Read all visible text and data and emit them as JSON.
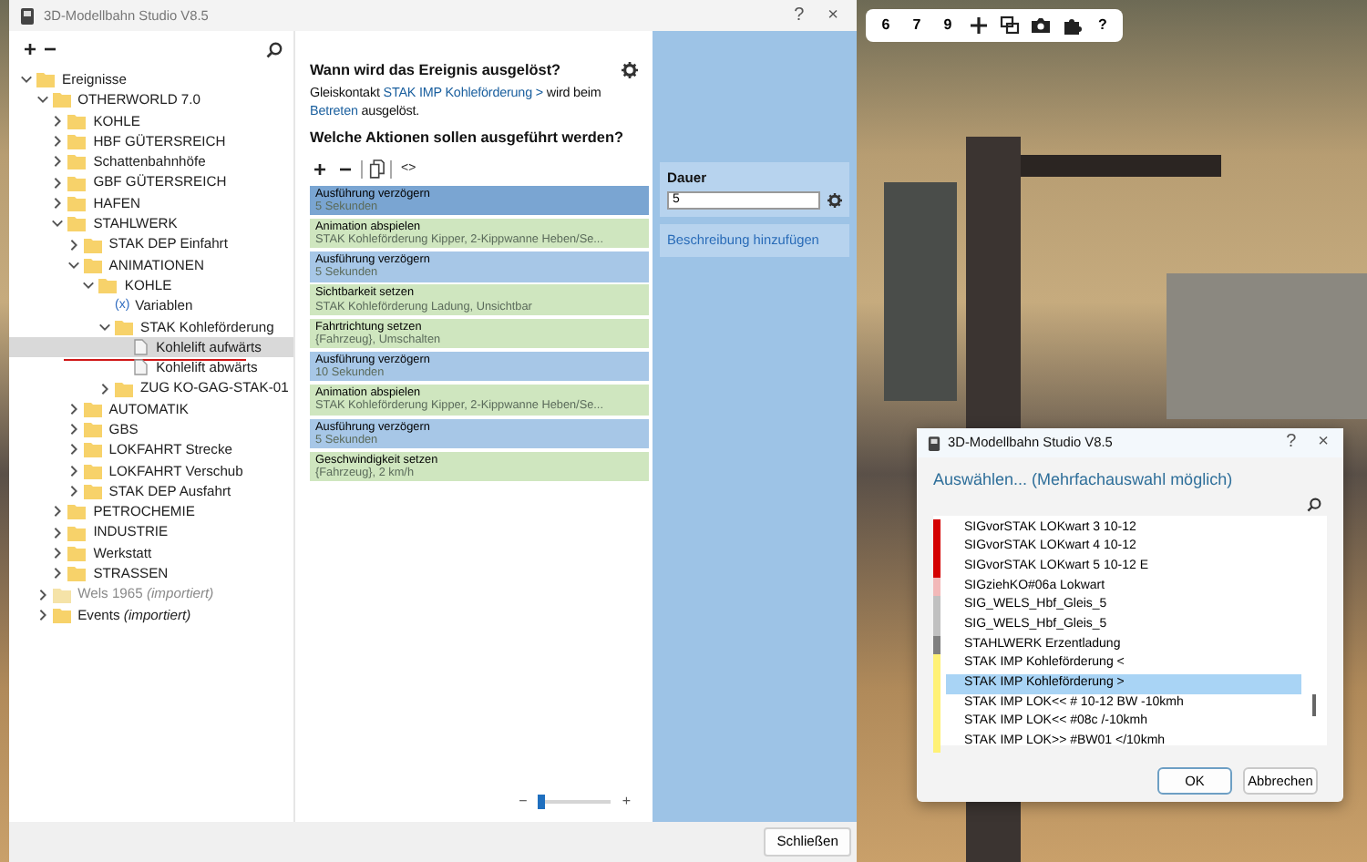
{
  "main_window": {
    "title": "3D-Modellbahn Studio V8.5",
    "help_button": "?",
    "close_button": "×"
  },
  "tree_toolbar": {
    "add_button": "+",
    "remove_button": "−"
  },
  "tree": [
    {
      "label": "Ereignisse",
      "kind": "folder",
      "expanded": true,
      "children": [
        {
          "label": "OTHERWORLD  7.0",
          "kind": "folder",
          "expanded": true,
          "children": [
            {
              "label": "KOHLE",
              "kind": "folder",
              "expanded": false
            },
            {
              "label": "HBF  GÜTERSREICH",
              "kind": "folder",
              "expanded": false
            },
            {
              "label": "Schattenbahnhöfe",
              "kind": "folder",
              "expanded": false
            },
            {
              "label": "GBF  GÜTERSREICH",
              "kind": "folder",
              "expanded": false
            },
            {
              "label": "HAFEN",
              "kind": "folder",
              "expanded": false
            },
            {
              "label": "STAHLWERK",
              "kind": "folder",
              "expanded": true,
              "children": [
                {
                  "label": "STAK  DEP  Einfahrt",
                  "kind": "folder",
                  "expanded": false
                },
                {
                  "label": "ANIMATIONEN",
                  "kind": "folder",
                  "expanded": true,
                  "children": [
                    {
                      "label": "KOHLE",
                      "kind": "folder",
                      "expanded": true,
                      "children": [
                        {
                          "label": "Variablen",
                          "kind": "variable",
                          "glyph": "(x)"
                        },
                        {
                          "label": "STAK  Kohleförderung",
                          "kind": "folder",
                          "expanded": true,
                          "children": [
                            {
                              "label": "Kohlelift aufwärts",
                              "kind": "document",
                              "selected": true,
                              "marked": true
                            },
                            {
                              "label": "Kohlelift abwärts",
                              "kind": "document",
                              "selected": false,
                              "marked": false
                            }
                          ]
                        },
                        {
                          "label": "ZUG  KO-GAG-STAK-01",
                          "kind": "folder",
                          "expanded": false
                        }
                      ]
                    }
                  ]
                },
                {
                  "label": "AUTOMATIK",
                  "kind": "folder",
                  "expanded": false
                },
                {
                  "label": "GBS",
                  "kind": "folder",
                  "expanded": false
                },
                {
                  "label": "LOKFAHRT  Strecke",
                  "kind": "folder",
                  "expanded": false
                },
                {
                  "label": "LOKFAHRT  Verschub",
                  "kind": "folder",
                  "expanded": false
                },
                {
                  "label": "STAK  DEP  Ausfahrt",
                  "kind": "folder",
                  "expanded": false
                }
              ]
            },
            {
              "label": "PETROCHEMIE",
              "kind": "folder",
              "expanded": false
            },
            {
              "label": "INDUSTRIE",
              "kind": "folder",
              "expanded": false
            },
            {
              "label": "Werkstatt",
              "kind": "folder",
              "expanded": false
            },
            {
              "label": "STRASSEN",
              "kind": "folder",
              "expanded": false
            }
          ]
        },
        {
          "label": "Wels 1965 *(importiert)*",
          "kind": "folder",
          "expanded": false,
          "disabled": true
        },
        {
          "label": "Events *(importiert)*",
          "kind": "folder",
          "expanded": false,
          "disabled": false
        }
      ]
    }
  ],
  "trigger": {
    "heading": "Wann wird das Ereignis ausgelöst?",
    "prefix": "Gleiskontakt",
    "contact_link": "STAK  IMP  Kohleförderung >",
    "middle": "wird beim",
    "event_link": "Betreten",
    "suffix": "ausgelöst."
  },
  "actions_heading": "Welche Aktionen sollen ausgeführt werden?",
  "actions_toolbar": {
    "add_button": "+",
    "remove_button": "−",
    "code_button": "<>"
  },
  "actions": [
    {
      "kind": "delay",
      "title": "Ausführung verzögern",
      "detail": "5 Sekunden",
      "selected": true
    },
    {
      "kind": "action",
      "title": "Animation abspielen",
      "detail": "STAK  Kohleförderung Kipper, 2-Kippwanne Heben/Se...",
      "selected": false
    },
    {
      "kind": "delay",
      "title": "Ausführung verzögern",
      "detail": "5 Sekunden",
      "selected": false
    },
    {
      "kind": "action",
      "title": "Sichtbarkeit setzen",
      "detail": "STAK  Kohleförderung Ladung, Unsichtbar",
      "selected": false
    },
    {
      "kind": "action",
      "title": "Fahrtrichtung setzen",
      "detail": "{Fahrzeug}, Umschalten",
      "selected": false
    },
    {
      "kind": "delay",
      "title": "Ausführung verzögern",
      "detail": "10 Sekunden",
      "selected": false
    },
    {
      "kind": "action",
      "title": "Animation abspielen",
      "detail": "STAK  Kohleförderung Kipper, 2-Kippwanne Heben/Se...",
      "selected": false
    },
    {
      "kind": "delay",
      "title": "Ausführung verzögern",
      "detail": "5 Sekunden",
      "selected": false
    },
    {
      "kind": "action",
      "title": "Geschwindigkeit setzen",
      "detail": "{Fahrzeug}, 2 km/h",
      "selected": false
    }
  ],
  "zoom_slider": {
    "minus": "−",
    "plus": "+",
    "level": 0.05
  },
  "properties": {
    "label": "Dauer",
    "value": "5",
    "description_link": "Beschreibung hinzufügen"
  },
  "close_button": "Schließen",
  "scene_toolbar": {
    "buttons": [
      {
        "kind": "text",
        "label": "6"
      },
      {
        "kind": "text",
        "label": "7"
      },
      {
        "kind": "text",
        "label": "9"
      },
      {
        "kind": "plus"
      },
      {
        "kind": "windows"
      },
      {
        "kind": "camera"
      },
      {
        "kind": "puzzle"
      },
      {
        "kind": "text",
        "label": "?"
      }
    ]
  },
  "dialog": {
    "title": "3D-Modellbahn Studio V8.5",
    "help_button": "?",
    "close_button": "×",
    "heading": "Auswählen... (Mehrfachauswahl möglich)",
    "items": [
      {
        "label": "SIGvorSTAK LOKwart 3 10-12",
        "color": "#d40000",
        "selected": false
      },
      {
        "label": "SIGvorSTAK LOKwart 4 10-12",
        "color": "#d40000",
        "selected": false
      },
      {
        "label": "SIGvorSTAK LOKwart 5 10-12 E",
        "color": "#d40000",
        "selected": false
      },
      {
        "label": "SIGziehKO#06a Lokwart",
        "color": "#f2b8b8",
        "selected": false
      },
      {
        "label": "SIG_WELS_Hbf_Gleis_5",
        "color": "#c0c0c0",
        "selected": false
      },
      {
        "label": "SIG_WELS_Hbf_Gleis_5",
        "color": "#c0c0c0",
        "selected": false
      },
      {
        "label": "STAHLWERK Erzentladung",
        "color": "#7f7f7f",
        "selected": false
      },
      {
        "label": "STAK  IMP  Kohleförderung <",
        "color": "#fff176",
        "selected": false
      },
      {
        "label": "STAK  IMP  Kohleförderung >",
        "color": "#fff176",
        "selected": true
      },
      {
        "label": "STAK IMP  LOK<<  # 10-12 BW -10kmh",
        "color": "#fff176",
        "selected": false
      },
      {
        "label": "STAK IMP  LOK<< #08c /-10kmh",
        "color": "#fff176",
        "selected": false
      },
      {
        "label": "STAK IMP  LOK>> #BW01 </10kmh",
        "color": "#fff176",
        "selected": false
      }
    ],
    "ok_button": "OK",
    "cancel_button": "Abbrechen"
  }
}
